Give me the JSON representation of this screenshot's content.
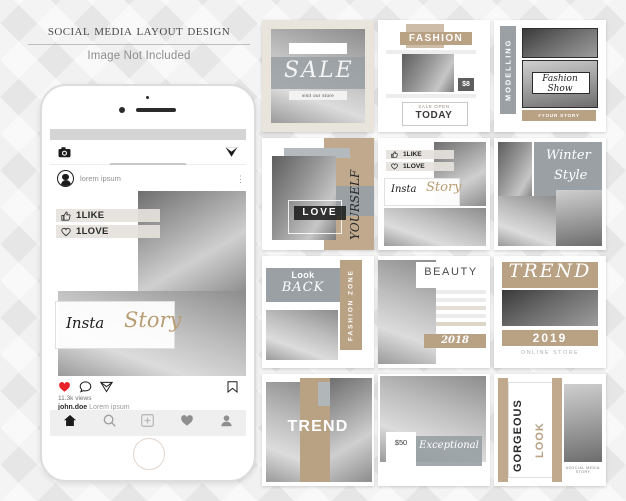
{
  "header": {
    "title": "Social Media Layout Design",
    "subtitle": "Image Not Included"
  },
  "phone": {
    "app_bar": {
      "camera_icon": "camera-icon",
      "send_icon": "paper-plane-icon"
    },
    "post": {
      "username": "lorem ipsum",
      "menu_icon": "more-options-icon",
      "like_label": "1LIKE",
      "love_label": "1LOVE",
      "script_word_1": "Insta",
      "script_word_2": "Story",
      "actions": {
        "like_icon": "heart-icon",
        "comment_icon": "comment-icon",
        "share_icon": "paper-plane-icon",
        "save_icon": "bookmark-icon"
      },
      "views": "11.3k views",
      "caption_user": "john.doe",
      "caption_text": "Lorem ipsum"
    },
    "post2_username": "lorem ipsum",
    "tabbar": {
      "home_icon": "home-icon",
      "search_icon": "search-icon",
      "add_icon": "add-post-icon",
      "activity_icon": "heart-icon",
      "profile_icon": "profile-icon"
    }
  },
  "colors": {
    "tan": "#b9a184",
    "gray": "#9aa0a3",
    "light_gray": "#c9cccd",
    "heart_red": "#e8242a",
    "background": "#e6e6e6"
  },
  "cards": [
    {
      "id": "sale",
      "headline": "SALE",
      "button": "visit our store"
    },
    {
      "id": "fashion",
      "headline": "FASHION",
      "price": "$8",
      "sub": "SALE OPEN",
      "cta": "TODAY"
    },
    {
      "id": "modelling",
      "vertical": "MODELLING",
      "script": "Fashion Show",
      "footer": "#YOUR STORY"
    },
    {
      "id": "love",
      "headline": "LOVE",
      "vertical": "YOURSELF"
    },
    {
      "id": "insta-story",
      "like_label": "1LIKE",
      "love_label": "1LOVE",
      "script_word_1": "Insta",
      "script_word_2": "Story"
    },
    {
      "id": "winter",
      "script_word_1": "Winter",
      "script_word_2": "Style"
    },
    {
      "id": "look-back",
      "small": "Look",
      "headline": "BACK",
      "vertical": "FASHION ZONE"
    },
    {
      "id": "beauty",
      "headline": "BEAUTY",
      "year": "2018"
    },
    {
      "id": "trend-2019",
      "script": "TREND",
      "year": "2019",
      "footer": "ONLINE STORE"
    },
    {
      "id": "trend",
      "headline": "TREND"
    },
    {
      "id": "exceptional",
      "price": "$50",
      "script": "Exceptional"
    },
    {
      "id": "gorgeous",
      "vertical": "GORGEOUS",
      "vertical2": "LOOK",
      "footer": "#SOCIAL MEDIA STORY"
    }
  ]
}
